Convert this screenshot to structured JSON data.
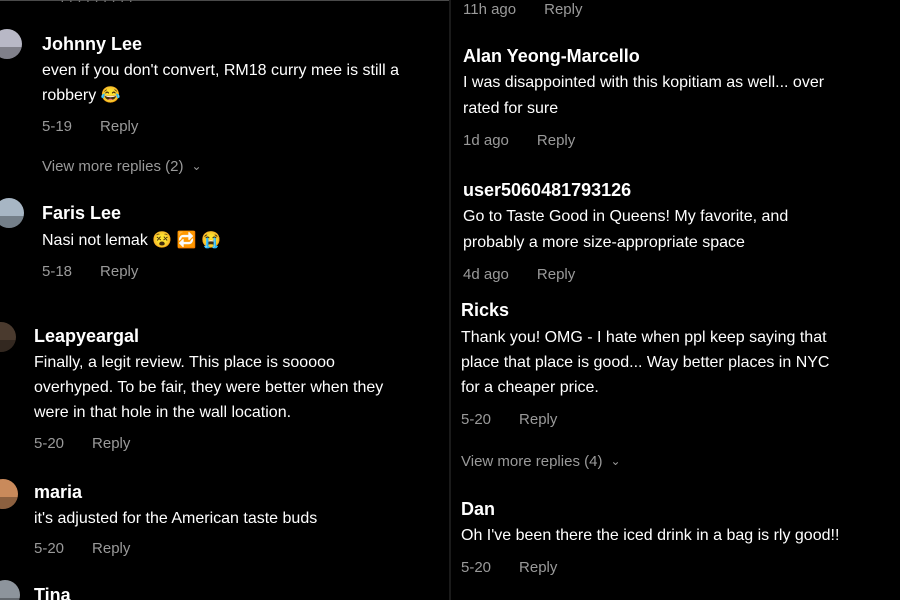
{
  "left": {
    "top_crop_text": "· · · · · · · · ·",
    "comments": [
      {
        "username": "Johnny Lee",
        "lines": [
          "even if you don't convert, RM18 curry mee is still a",
          "robbery 😂"
        ],
        "date": "5-19",
        "reply": "Reply",
        "avatar_color": "#b8b8c6"
      },
      {
        "view_more": "View more replies (2)"
      },
      {
        "username": "Faris Lee",
        "lines": [
          "Nasi not lemak 😵 🔁 😭"
        ],
        "date": "5-18",
        "reply": "Reply",
        "avatar_color": "#a7b6c4"
      },
      {
        "username": "Leapyeargal",
        "lines": [
          "Finally, a legit review. This place is sooooo",
          "overhyped. To be fair, they were better when they",
          "were in that hole in the wall location."
        ],
        "date": "5-20",
        "reply": "Reply",
        "avatar_color": "#4a3a2e"
      },
      {
        "username": "maria",
        "lines": [
          "it's adjusted for the American taste buds"
        ],
        "date": "5-20",
        "reply": "Reply",
        "avatar_color": "#c98a5b"
      },
      {
        "username": "Tina",
        "avatar_color": "#8d949c"
      }
    ]
  },
  "right": {
    "top_meta": {
      "date": "11h ago",
      "reply": "Reply"
    },
    "comments": [
      {
        "username": "Alan Yeong-Marcello",
        "lines": [
          "I was disappointed with this kopitiam as well... over",
          "rated for sure"
        ],
        "date": "1d ago",
        "reply": "Reply"
      },
      {
        "username": "user5060481793126",
        "lines": [
          "Go to Taste Good in Queens! My favorite, and",
          "probably a more size-appropriate space"
        ],
        "date": "4d ago",
        "reply": "Reply"
      },
      {
        "username": "Ricks",
        "lines": [
          "Thank you! OMG - I hate when ppl keep saying that",
          "place that place is good... Way better places in NYC",
          "for a cheaper price."
        ],
        "date": "5-20",
        "reply": "Reply"
      },
      {
        "view_more": "View more replies (4)"
      },
      {
        "username": "Dan",
        "lines": [
          "Oh I've been there the iced drink in a bag is rly good!!"
        ],
        "date": "5-20",
        "reply": "Reply"
      }
    ]
  },
  "colors": {
    "background": "#000000",
    "text": "#ffffff",
    "muted": "#9a9a9a"
  },
  "icons": {
    "chevron": "chevron-down-icon"
  }
}
